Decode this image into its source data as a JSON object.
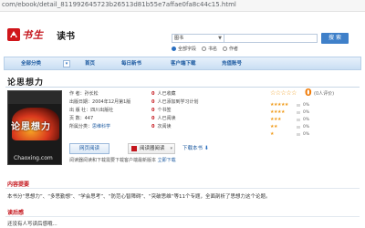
{
  "browser": {
    "url": "com/ebook/detail_811992645723b26513d81b55e7affae0fa8c44c15.html"
  },
  "brand": {
    "logo_text": "书生",
    "product_name": "读书"
  },
  "search": {
    "type_value": "图书",
    "input_value": "",
    "button_label": "搜 索",
    "scopes": [
      {
        "label": "全部字段",
        "checked": true
      },
      {
        "label": "书名",
        "checked": false
      },
      {
        "label": "作者",
        "checked": false
      }
    ]
  },
  "nav": {
    "category_label": "全部分类",
    "items": [
      "首页",
      "每日新书",
      "客户端下载",
      "充值账号"
    ]
  },
  "book": {
    "title": "论思想力",
    "cover": {
      "title": "论思想力",
      "watermark": "Chaoxing.com"
    },
    "meta": [
      {
        "label": "作 者：",
        "value": "孙长松"
      },
      {
        "label": "出版日期：",
        "value": "2004年12月第1版"
      },
      {
        "label": "出 版 社：",
        "value": "四川出版社"
      },
      {
        "label": "页 数：",
        "value": "447"
      },
      {
        "label": "所属分类：",
        "value": "思维科学",
        "is_link": true
      }
    ],
    "stats": [
      {
        "count": "0",
        "label": "人已收藏"
      },
      {
        "count": "0",
        "label": "人已添加到学习计划"
      },
      {
        "count": "0",
        "label": "个书签"
      },
      {
        "count": "0",
        "label": "人已阅读"
      },
      {
        "count": "0",
        "label": "次阅读"
      }
    ]
  },
  "rating": {
    "score": "0",
    "count_text": "(0人评价)",
    "star_level": 0,
    "breakdown": [
      {
        "stars": "★★★★★",
        "percent": "0%"
      },
      {
        "stars": "★★★★",
        "percent": "0%"
      },
      {
        "stars": "★★★",
        "percent": "0%"
      },
      {
        "stars": "★★",
        "percent": "0%"
      },
      {
        "stars": "★",
        "percent": "0%"
      }
    ]
  },
  "actions": {
    "read_label": "网页阅读",
    "fav_label": "阅读器阅读",
    "download_label": "下载本书",
    "hint_text": "阅读器阅读和下载需要下载客户端最新版本",
    "hint_link": "立即下载"
  },
  "sections": {
    "intro_title": "内容提要",
    "intro_text": "本书分“思想力”、“多思勤想”、“学会思考”、“防范心智障碍”、“突破思维“等11个专题，全面剖析了思想力这个论题。",
    "reader_title": "读后感",
    "reader_text": "还没有人写读后感哦..."
  },
  "colors": {
    "brand_red": "#c4151c",
    "link_blue": "#1d5aa0",
    "accent_blue": "#3f80c9",
    "star_orange": "#f09b1a"
  }
}
